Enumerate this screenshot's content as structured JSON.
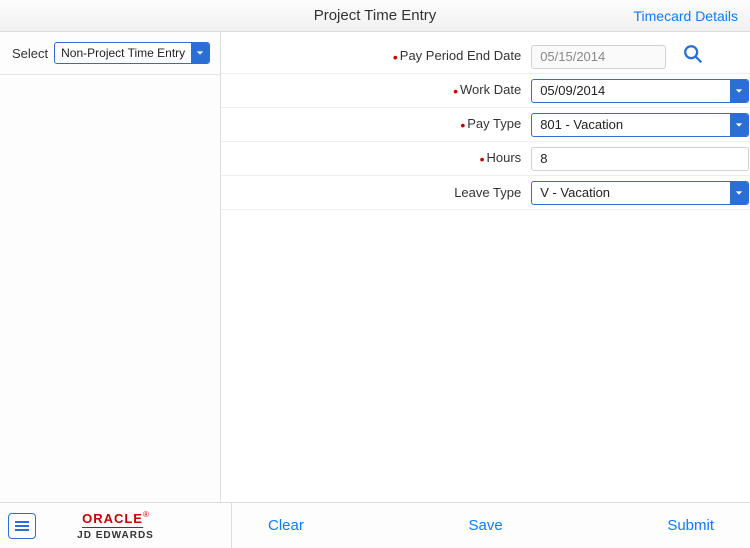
{
  "header": {
    "title": "Project Time Entry",
    "details_link": "Timecard Details"
  },
  "left": {
    "select_label": "Select",
    "select_value": "Non-Project Time Entry"
  },
  "form": {
    "pay_period_label": "Pay Period End Date",
    "pay_period_value": "05/15/2014",
    "work_date_label": "Work Date",
    "work_date_value": "05/09/2014",
    "pay_type_label": "Pay Type",
    "pay_type_value": "801 - Vacation",
    "hours_label": "Hours",
    "hours_value": "8",
    "leave_type_label": "Leave Type",
    "leave_type_value": "V - Vacation"
  },
  "footer": {
    "brand_top": "ORACLE",
    "brand_sub": "JD EDWARDS",
    "clear": "Clear",
    "save": "Save",
    "submit": "Submit"
  }
}
